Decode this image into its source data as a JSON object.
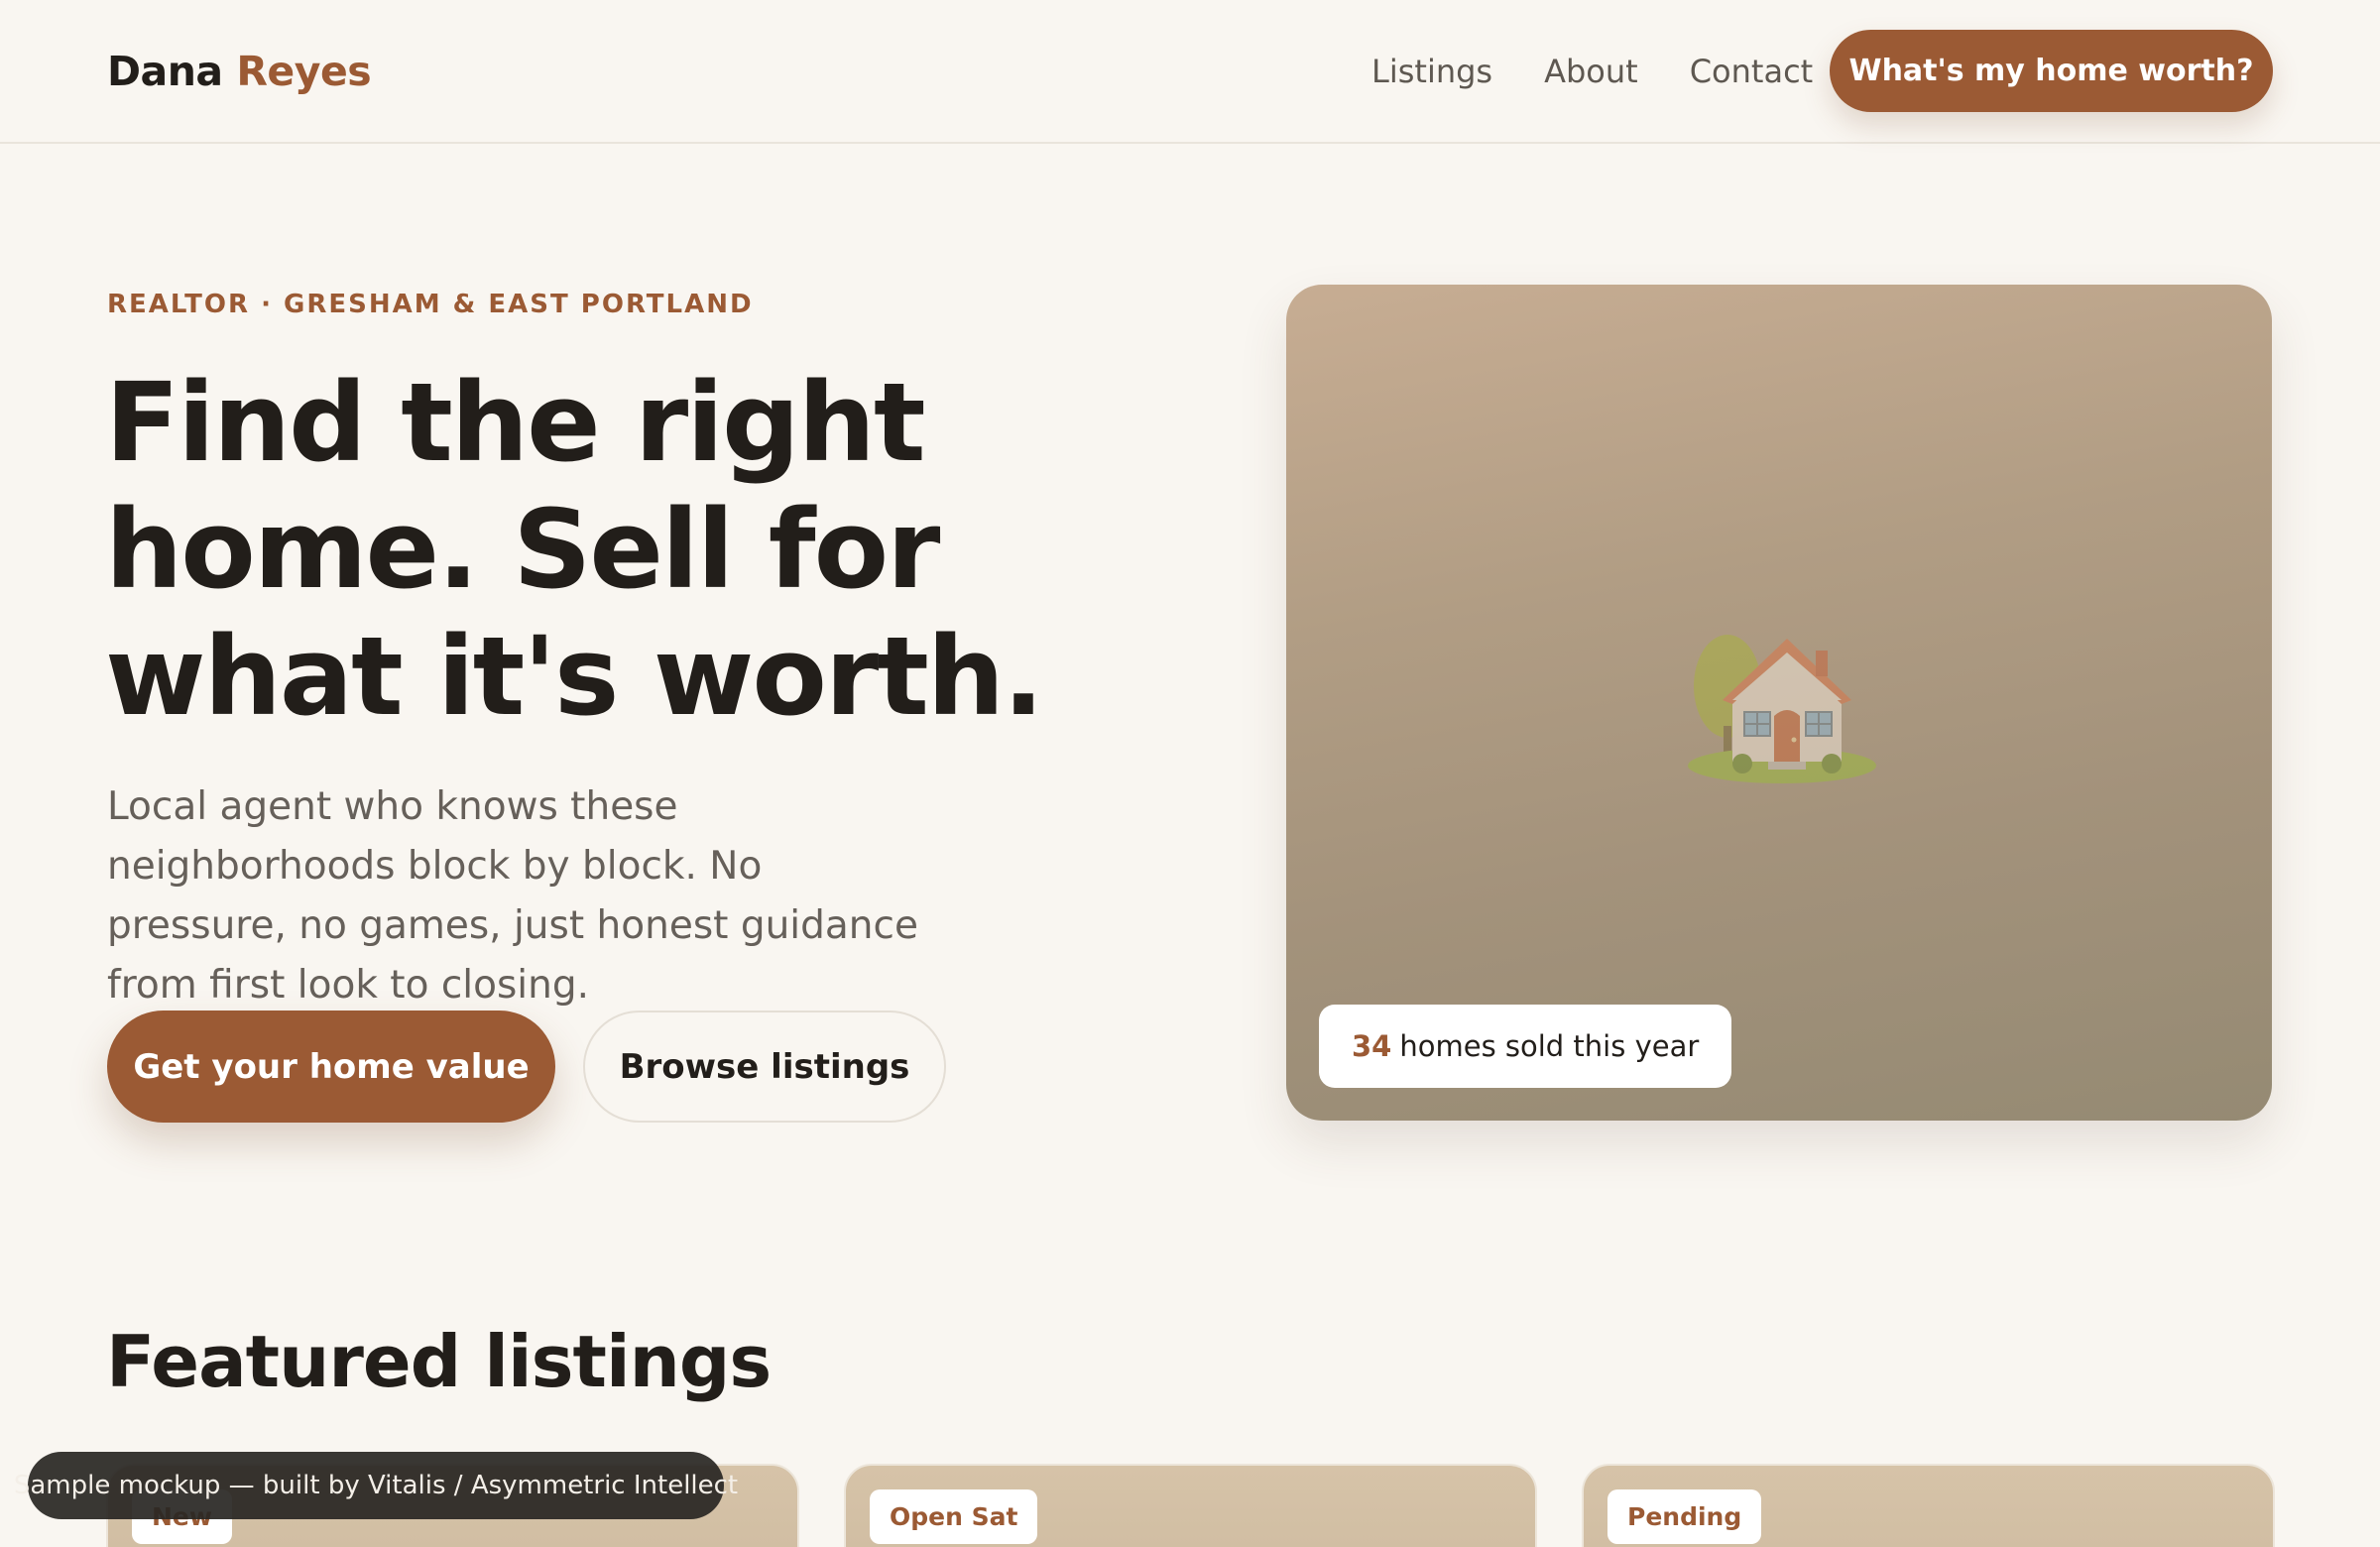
{
  "header": {
    "brand_first": "Dana",
    "brand_last": "Reyes",
    "nav": [
      {
        "label": "Listings"
      },
      {
        "label": "About"
      },
      {
        "label": "Contact"
      }
    ],
    "cta_label": "What's my home worth?"
  },
  "hero": {
    "eyebrow": "REALTOR · GRESHAM & EAST PORTLAND",
    "title": "Find the right home. Sell for what it's worth.",
    "subtitle": "Local agent who knows these neighborhoods block by block. No pressure, no games, just honest guidance from first look to closing.",
    "primary_button": "Get your home value",
    "secondary_button": "Browse listings",
    "image_icon": "house-with-garden-icon",
    "stats": {
      "number": "34",
      "text": "homes sold this year"
    }
  },
  "featured": {
    "title": "Featured listings",
    "cards": [
      {
        "badge": "New"
      },
      {
        "badge": "Open Sat"
      },
      {
        "badge": "Pending"
      }
    ]
  },
  "toast": {
    "text": "Sample mockup — built by Vitalis / Asymmetric Intellect"
  },
  "colors": {
    "accent": "#9b5a34",
    "background": "#f9f6f1",
    "text": "#221e1a",
    "muted": "#66605a"
  }
}
